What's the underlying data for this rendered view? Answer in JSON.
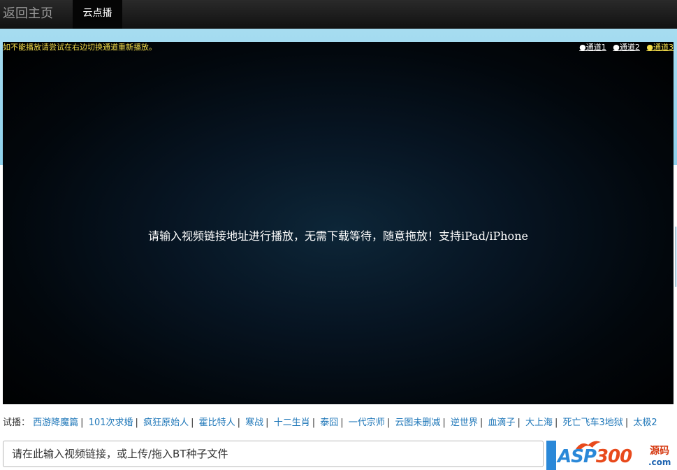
{
  "header": {
    "home_label": "返回主页",
    "tab_label": "云点播"
  },
  "player": {
    "notice": "如不能播放请尝试在右边切换通道重新播放。",
    "channels": [
      "●通道1",
      "●通道2",
      "●通道3"
    ],
    "active_channel_index": 2,
    "message": "请输入视频链接地址进行播放，无需下载等待，随意拖放！支持iPad/iPhone"
  },
  "tries": {
    "label": "试播：",
    "items": [
      "西游降魔篇",
      "101次求婚",
      "疯狂原始人",
      "霍比特人",
      "寒战",
      "十二生肖",
      "泰囧",
      "一代宗师",
      "云图未删减",
      "逆世界",
      "血滴子",
      "大上海",
      "死亡飞车3地狱",
      "太极2"
    ]
  },
  "input": {
    "placeholder": "请在此输入视频链接，或上传/拖入BT种子文件"
  },
  "logo": {
    "asp": "ASP",
    "num": "300",
    "ym": "源码",
    "com": ".com"
  },
  "colors": {
    "link": "#1d76b8",
    "notice": "#f3dd4a",
    "accent": "#2a88d8"
  }
}
